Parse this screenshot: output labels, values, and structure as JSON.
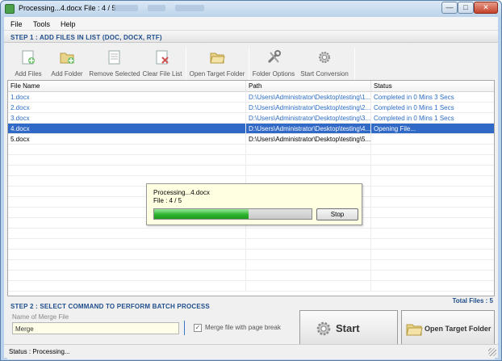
{
  "window": {
    "title": "Processing...4.docx File : 4 / 5",
    "minimize_label": "—",
    "maximize_label": "□",
    "close_label": "✕"
  },
  "menu": [
    "File",
    "Tools",
    "Help"
  ],
  "step1": {
    "label": "STEP 1 : ADD FILES IN LIST (DOC, DOCX, RTF)"
  },
  "toolbar": {
    "buttons": [
      {
        "label": "Add Files",
        "icon": "add-files-icon"
      },
      {
        "label": "Add Folder",
        "icon": "add-folder-icon"
      },
      {
        "label": "Remove Selected",
        "icon": "remove-selected-icon"
      },
      {
        "label": "Clear File List",
        "icon": "clear-list-icon"
      },
      {
        "label": "Open Target Folder",
        "icon": "open-folder-icon"
      },
      {
        "label": "Folder Options",
        "icon": "tools-icon"
      },
      {
        "label": "Start Conversion",
        "icon": "gear-icon"
      }
    ]
  },
  "table": {
    "columns": [
      "File Name",
      "Path",
      "Status"
    ],
    "rows": [
      {
        "name": "1.docx",
        "path": "D:\\Users\\Administrator\\Desktop\\testing\\1...",
        "status": "Completed in 0 Mins 3 Secs",
        "state": "done"
      },
      {
        "name": "2.docx",
        "path": "D:\\Users\\Administrator\\Desktop\\testing\\2...",
        "status": "Completed in 0 Mins 1 Secs",
        "state": "done"
      },
      {
        "name": "3.docx",
        "path": "D:\\Users\\Administrator\\Desktop\\testing\\3...",
        "status": "Completed in 0 Mins 1 Secs",
        "state": "done"
      },
      {
        "name": "4.docx",
        "path": "D:\\Users\\Administrator\\Desktop\\testing\\4...",
        "status": "Opening File...",
        "state": "active"
      },
      {
        "name": "5.docx",
        "path": "D:\\Users\\Administrator\\Desktop\\testing\\5...",
        "status": "",
        "state": "pending"
      }
    ]
  },
  "progress_dialog": {
    "line1": "Processing...4.docx",
    "line2": "File : 4 / 5",
    "progress_fraction": 0.6,
    "stop_label": "Stop"
  },
  "total_files": "Total Files : 5",
  "step2": {
    "label": "STEP 2 : SELECT COMMAND TO PERFORM BATCH PROCESS"
  },
  "merge": {
    "label": "Name of Merge File",
    "value": "Merge",
    "checkbox_label": "Merge file with page break",
    "checkbox_mark": "✓"
  },
  "buttons": {
    "start": "Start",
    "open_target": "Open Target Folder"
  },
  "status": {
    "text": "Status  :  Processing..."
  },
  "colors": {
    "accent": "#1f4e8c",
    "link": "#2b6cc4",
    "selection": "#3169c6",
    "progress": "#2fb52f"
  }
}
